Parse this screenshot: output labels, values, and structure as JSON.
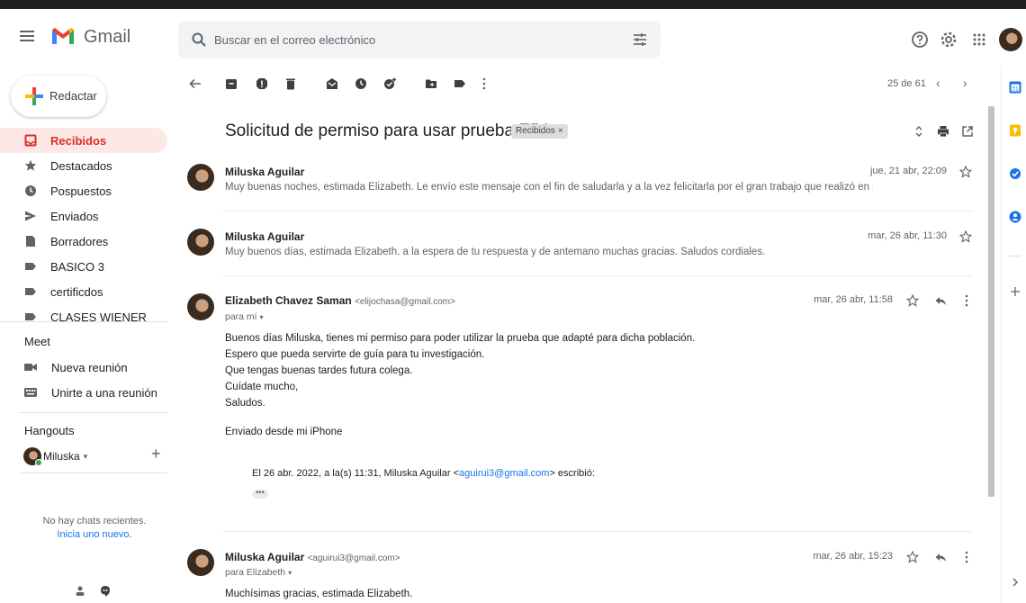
{
  "header": {
    "app_name": "Gmail",
    "search_placeholder": "Buscar en el correo electrónico"
  },
  "sidebar": {
    "compose_label": "Redactar",
    "items": [
      {
        "label": "Recibidos",
        "icon": "inbox-icon",
        "active": true
      },
      {
        "label": "Destacados",
        "icon": "star-icon"
      },
      {
        "label": "Pospuestos",
        "icon": "clock-icon"
      },
      {
        "label": "Enviados",
        "icon": "send-icon"
      },
      {
        "label": "Borradores",
        "icon": "draft-icon"
      },
      {
        "label": "BASICO 3",
        "icon": "label-icon"
      },
      {
        "label": "certificdos",
        "icon": "label-icon"
      },
      {
        "label": "CLASES WIENER",
        "icon": "label-icon"
      }
    ],
    "meet": {
      "title": "Meet",
      "new_meeting": "Nueva reunión",
      "join_meeting": "Unirte a una reunión"
    },
    "hangouts": {
      "title": "Hangouts",
      "user": "Miluska",
      "no_chats": "No hay chats recientes.",
      "start_new": "Inicia uno nuevo."
    }
  },
  "toolbar": {
    "pager": "25 de 61"
  },
  "thread": {
    "subject": "Solicitud de permiso para usar prueba EPA",
    "label_chip": "Recibidos",
    "label_chip_close": "×",
    "messages": [
      {
        "sender": "Miluska Aguilar",
        "date": "jue, 21 abr, 22:09",
        "snippet": "Muy buenas noches, estimada Elizabeth. Le envío este mensaje con el fin de saludarla y a la vez felicitarla por el gran trabajo que realizó en su tesis \"Propied"
      },
      {
        "sender": "Miluska Aguilar",
        "date": "mar, 26 abr, 11:30",
        "snippet": "Muy buenos días, estimada Elizabeth. a la espera de tu respuesta y de antemano muchas gracias. Saludos cordiales."
      },
      {
        "sender": "Elizabeth Chavez Saman",
        "email": "<elijochasa@gmail.com>",
        "to": "para mí",
        "date": "mar, 26 abr, 11:58",
        "body": [
          "Buenos días Miluska, tienes mi permiso para poder utilizar la prueba que adapté para dicha población.",
          "Espero que pueda servirte de guía para tu investigación.",
          "Que tengas buenas tardes futura colega.",
          "Cuídate mucho,",
          "Saludos."
        ],
        "signature": "Enviado desde mi iPhone",
        "quote_prefix": "El 26 abr. 2022, a la(s) 11:31, Miluska Aguilar <",
        "quote_link": "aguirui3@gmail.com",
        "quote_suffix": "> escribió:",
        "dots": "•••"
      },
      {
        "sender": "Miluska Aguilar",
        "email": "<aguirui3@gmail.com>",
        "to": "para Elizabeth",
        "date": "mar, 26 abr, 15:23",
        "body_first": "Muchísimas gracias, estimada Elizabeth."
      }
    ]
  },
  "colors": {
    "active_bg": "#fce8e6",
    "active_text": "#d93025",
    "link": "#1a73e8"
  }
}
